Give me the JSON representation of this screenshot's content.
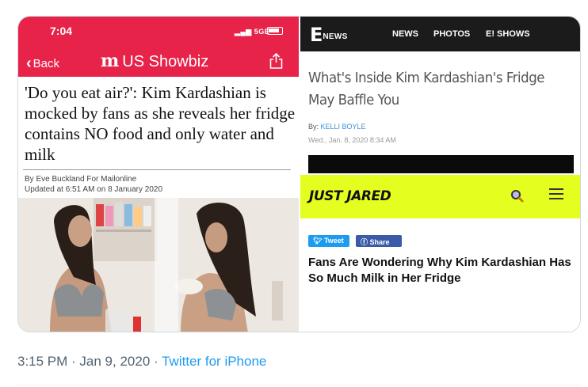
{
  "daily_mail": {
    "status_time": "7:04",
    "status_signal": "5GE",
    "back_label": "Back",
    "brand_mark": "m",
    "brand_label": "US Showbiz",
    "headline": "'Do you eat air?': Kim Kardashian is mocked by fans as she reveals her fridge contains NO food and only water and milk",
    "byline": "By Eve Buckland For Mailonline",
    "updated": "Updated at 6:51 AM on 8 January 2020",
    "accent_color": "#e8234a"
  },
  "enews": {
    "logo_e": "E",
    "logo_news": "NEWS",
    "menu": [
      "NEWS",
      "PHOTOS",
      "E! SHOWS"
    ],
    "title": "What's Inside Kim Kardashian's Fridge May Baffle You",
    "by_label": "By:",
    "author": "KELLI BOYLE",
    "date": "Wed., Jan. 8, 2020 8:34 AM"
  },
  "justjared": {
    "logo": "JUST JARED",
    "tweet_label": "Tweet",
    "share_label": "Share",
    "title": "Fans Are Wondering Why Kim Kardashian Has So Much Milk in Her Fridge",
    "accent_color": "#e4ff1f"
  },
  "tweet_meta": {
    "time": "3:15 PM",
    "sep1": " · ",
    "date": "Jan 9, 2020",
    "sep2": " · ",
    "source": "Twitter for iPhone"
  }
}
